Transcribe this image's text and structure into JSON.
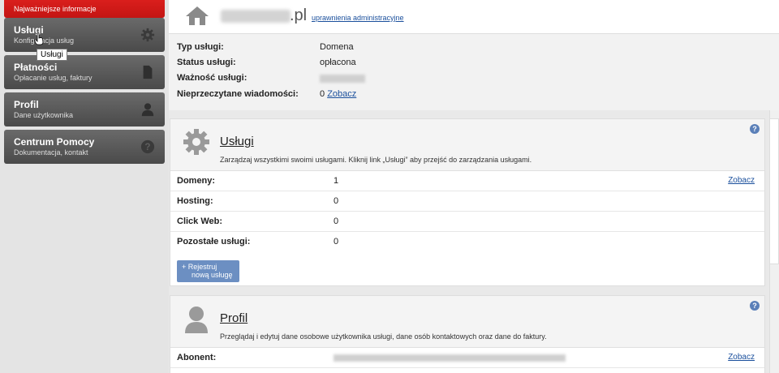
{
  "sidebar": {
    "top_item": {
      "subtitle": "Najważniejsze informacje"
    },
    "items": [
      {
        "title": "Usługi",
        "subtitle": "Konfiguracja usług",
        "icon": "gear-icon"
      },
      {
        "title": "Płatności",
        "subtitle": "Opłacanie usług, faktury",
        "icon": "document-icon"
      },
      {
        "title": "Profil",
        "subtitle": "Dane użytkownika",
        "icon": "user-icon"
      },
      {
        "title": "Centrum Pomocy",
        "subtitle": "Dokumentacja, kontakt",
        "icon": "help-icon"
      }
    ],
    "tooltip": "Usługi"
  },
  "header": {
    "domain_tld": ".pl",
    "admin_link": "uprawnienia administracyjne"
  },
  "info": {
    "rows": [
      {
        "label": "Typ usługi:",
        "value": "Domena"
      },
      {
        "label": "Status usługi:",
        "value": "opłacona"
      },
      {
        "label": "Ważność usługi:",
        "value": ""
      },
      {
        "label": "Nieprzeczytane wiadomości:",
        "value": "0",
        "link": "Zobacz"
      }
    ]
  },
  "services": {
    "title": "Usługi",
    "description": "Zarządzaj wszystkimi swoimi usługami. Kliknij link „Usługi” aby przejść do zarządzania usługami.",
    "rows": [
      {
        "label": "Domeny:",
        "value": "1",
        "link": "Zobacz"
      },
      {
        "label": "Hosting:",
        "value": "0"
      },
      {
        "label": "Click Web:",
        "value": "0"
      },
      {
        "label": "Pozostałe usługi:",
        "value": "0"
      }
    ],
    "register_line1": "+ Rejestruj",
    "register_line2": "nową usługę",
    "help": "?"
  },
  "profile": {
    "title": "Profil",
    "description": "Przeglądaj i edytuj dane osobowe użytkownika usługi, dane osób kontaktowych oraz dane do faktury.",
    "rows": [
      {
        "label": "Abonent:",
        "link": "Zobacz"
      }
    ],
    "help": "?"
  },
  "colors": {
    "accent_red": "#d71b19",
    "link_blue": "#1a4f9c",
    "button_blue": "#6c8fc2"
  }
}
